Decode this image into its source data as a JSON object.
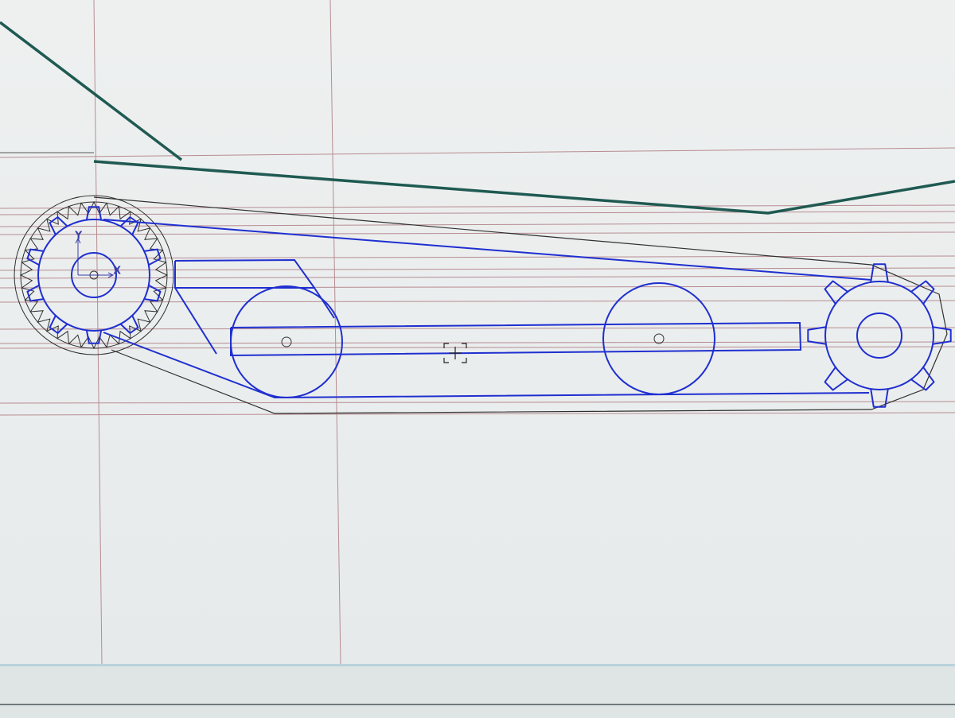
{
  "app": {
    "kind": "CAD drawing viewport"
  },
  "ucs": {
    "x_label": "X",
    "y_label": "Y"
  },
  "colors": {
    "geometry": "#1f2fd0",
    "reference_line": "#b68c92",
    "frame_line": "#1f5a52",
    "outline": "#2f2f2f",
    "background": "#ebeeee"
  },
  "icons": {
    "crosshair": "cursor-crosshair-icon",
    "ucs": "ucs-axis-icon"
  }
}
